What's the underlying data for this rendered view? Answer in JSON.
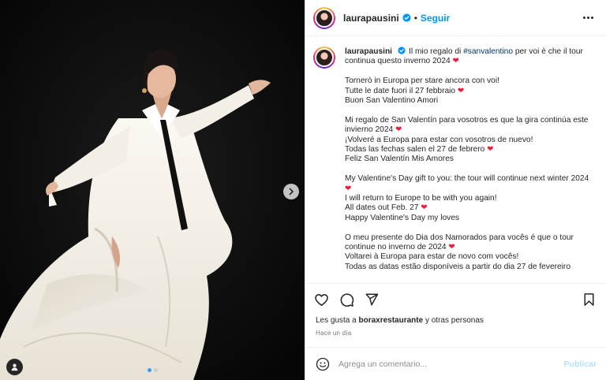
{
  "post": {
    "username": "laurapausini",
    "follow_label": "Seguir",
    "separator": "•"
  },
  "caption": {
    "username": "laurapausini",
    "intro_before_tag": "Il mio regalo di ",
    "hashtag": "#sanvalentino",
    "intro_after_tag": " per voi è che il tour continua questo inverno 2024 ",
    "paragraphs": [
      {
        "lines": [
          {
            "text": "Tornerò in Europa per stare ancora con voi!",
            "heart": false
          },
          {
            "text": "Tutte le date fuori il 27 febbraio ",
            "heart": true
          },
          {
            "text": "Buon San Valentino Amori",
            "heart": false
          }
        ]
      },
      {
        "lines": [
          {
            "text": "Mi regalo de San Valentín para vosotros es que la gira continúa este invierno 2024 ",
            "heart": true
          },
          {
            "text": "¡Volveré a Europa para estar con vosotros de nuevo!",
            "heart": false
          },
          {
            "text": "Todas las fechas salen el 27 de febrero ",
            "heart": true
          },
          {
            "text": "Feliz San Valentín Mis Amores",
            "heart": false
          }
        ]
      },
      {
        "lines": [
          {
            "text": "My Valentine's Day gift to you: the tour will continue next winter 2024 ",
            "heart": true
          },
          {
            "text": "I will return to Europe to be with you again!",
            "heart": false
          },
          {
            "text": "All dates out Feb. 27 ",
            "heart": true
          },
          {
            "text": "Happy Valentine's Day my loves",
            "heart": false
          }
        ]
      },
      {
        "lines": [
          {
            "text": "O meu presente do Dia dos Namorados para vocês é que o tour continue no inverno de 2024 ",
            "heart": true
          },
          {
            "text": "Voltarei à Europa para estar de novo com vocês!",
            "heart": false
          },
          {
            "text": "Todas as datas estão disponíveis a partir do dia 27 de fevereiro",
            "heart": false
          }
        ]
      }
    ],
    "heart_glyph": "❤"
  },
  "likes": {
    "prefix": "Les gusta a ",
    "user": "boraxrestaurante",
    "suffix": " y otras personas"
  },
  "timestamp": "Hace un día",
  "comment": {
    "placeholder": "Agrega un comentario...",
    "publish_label": "Publicar"
  },
  "icons": {
    "verified": "verified-badge-icon",
    "like": "heart-outline-icon",
    "comment": "comment-bubble-icon",
    "share": "paper-plane-icon",
    "save": "bookmark-icon",
    "emoji": "smiley-icon",
    "next": "chevron-right-icon",
    "tag": "user-tag-icon"
  },
  "colors": {
    "accent": "#0095f6",
    "heart": "#ed1c3c",
    "hashtag": "#00376b",
    "publish_disabled": "#b2dffc"
  },
  "carousel": {
    "count": 2,
    "active": 1
  }
}
